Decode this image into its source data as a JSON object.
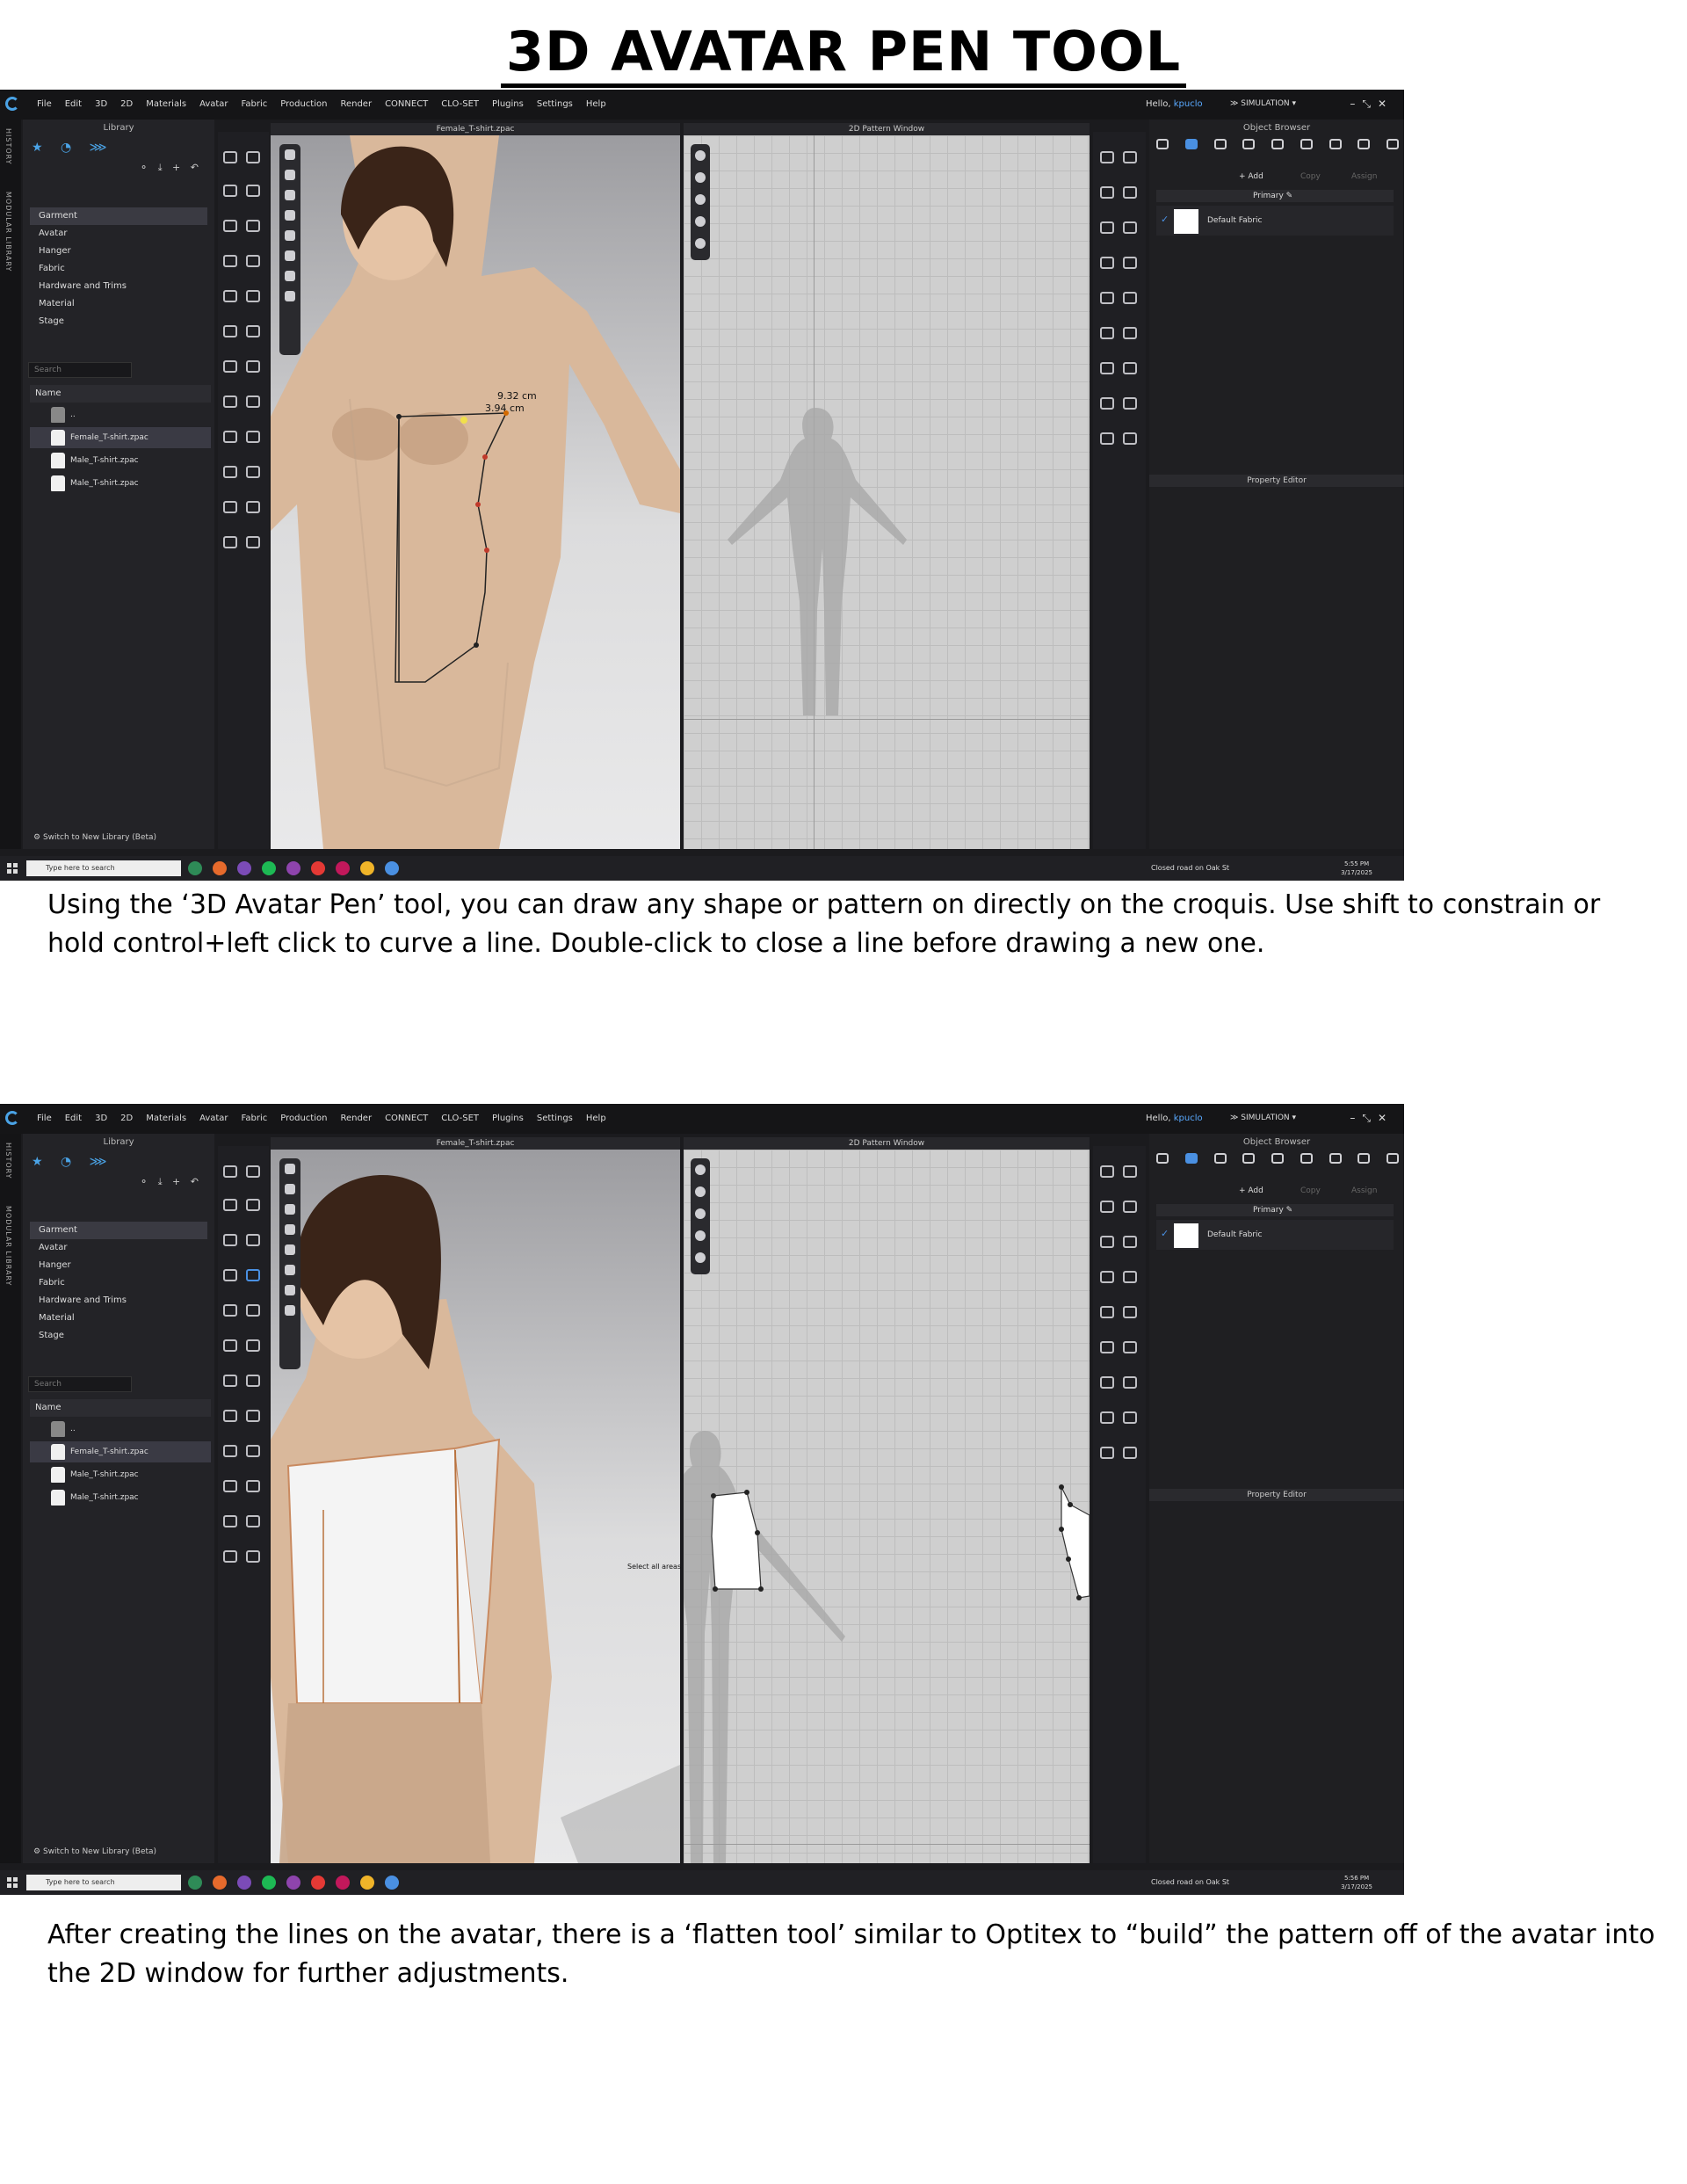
{
  "title": "3D AVATAR PEN TOOL",
  "app": {
    "menu": [
      "File",
      "Edit",
      "3D",
      "2D",
      "Materials",
      "Avatar",
      "Fabric",
      "Production",
      "Render",
      "CONNECT",
      "CLO-SET",
      "Plugins",
      "Settings",
      "Help"
    ],
    "greeting": "Hello,",
    "user": "kpuclo",
    "mode": "SIMULATION",
    "side_tabs": [
      "HISTORY",
      "MODULAR LIBRARY"
    ],
    "library": {
      "title": "Library",
      "tree": [
        "Garment",
        "Avatar",
        "Hanger",
        "Fabric",
        "Hardware and Trims",
        "Material",
        "Stage"
      ],
      "search_placeholder": "Search",
      "column_name": "Name",
      "files": [
        "..",
        "Female_T-shirt.zpac",
        "Male_T-shirt.zpac",
        "Male_T-shirt.zpac"
      ],
      "switch_label": "Switch to New Library (Beta)"
    },
    "view3d_title": "Female_T-shirt.zpac",
    "view2d_title": "2D Pattern Window",
    "object_browser": {
      "title": "Object Browser",
      "add": "+ Add",
      "copy": "Copy",
      "assign": "Assign",
      "primary": "Primary",
      "fabric": "Default Fabric"
    },
    "property_editor": "Property Editor",
    "taskbar": {
      "search": "Type here to search",
      "weather": "Closed road on Oak St",
      "date": "3/17/2025"
    }
  },
  "screens": [
    {
      "measure1": "9.32 cm",
      "measure2": "3.94 cm",
      "time": "5:55 PM",
      "caption": "Using the ‘3D Avatar Pen’ tool, you can draw any shape or pattern on directly on the croquis. Use shift to constrain or hold control+left click to curve a line. Double-click to close a line before drawing a new one."
    },
    {
      "tooltip": "Select all areas",
      "time": "5:56 PM",
      "caption": "After creating the lines on the avatar, there is a ‘flatten tool’ similar to Optitex to “build” the pattern off of the avatar into the 2D window for further adjustments."
    }
  ]
}
